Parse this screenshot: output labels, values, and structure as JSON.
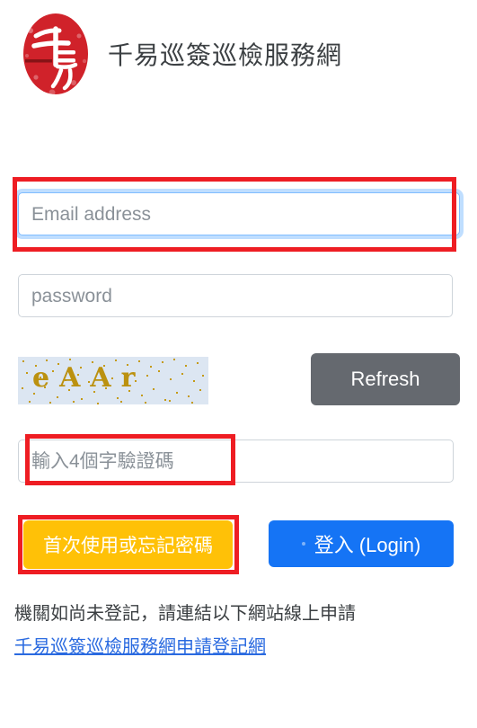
{
  "header": {
    "logo_icon": "red-seal-stamp-logo",
    "title": "千易巡簽巡檢服務網"
  },
  "form": {
    "email": {
      "placeholder": "Email address",
      "value": "",
      "focused": true
    },
    "password": {
      "placeholder": "password",
      "value": ""
    },
    "captcha": {
      "image_text": "eAAr",
      "image_bg_color": "#dce6f2",
      "image_text_color": "#bb9110",
      "refresh_label": "Refresh",
      "refresh_color": "#65696f",
      "input_placeholder": "輸入4個字驗證碼",
      "input_value": ""
    },
    "forgot_button": {
      "label": "首次使用或忘記密碼",
      "color": "#ffc107"
    },
    "login_button": {
      "label": "登入 (Login)",
      "color": "#1574f5"
    }
  },
  "footer": {
    "note": "機關如尚未登記，請連結以下網站線上申請",
    "link_text": "千易巡簽巡檢服務網申請登記網",
    "link_color": "#2a6ae0"
  },
  "annotations": {
    "color": "#ee1d23",
    "boxes": [
      {
        "target": "email-field"
      },
      {
        "target": "captcha-input"
      },
      {
        "target": "forgot-button"
      }
    ]
  }
}
